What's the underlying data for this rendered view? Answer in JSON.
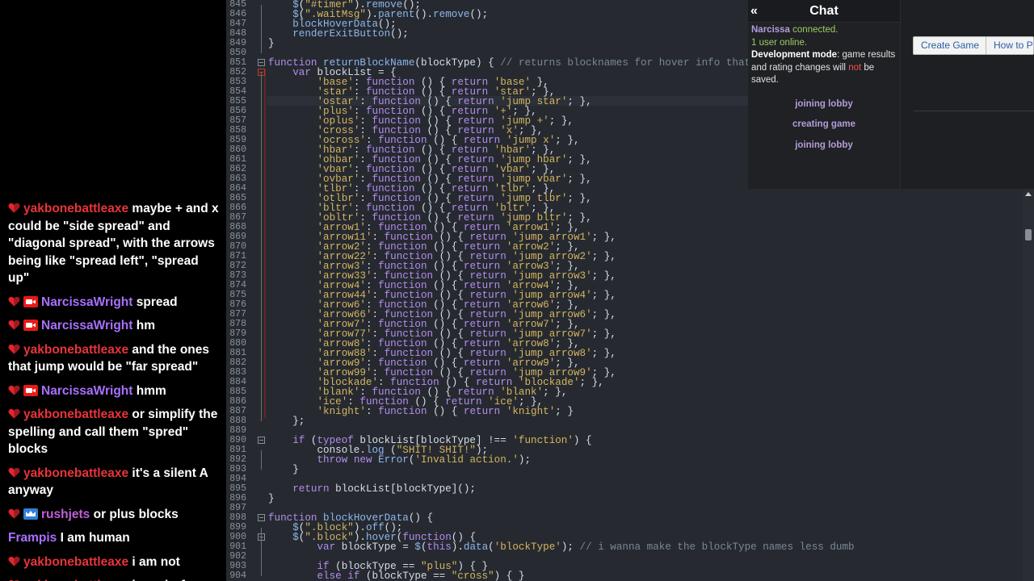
{
  "stream_chat": {
    "messages": [
      {
        "user": "yakbonebattleaxe",
        "color": "#e8343a",
        "badges": [
          "heart"
        ],
        "text": "maybe + and x could be \"side spread\" and \"diagonal spread\", with the arrows being like \"spread left\", \"spread up\""
      },
      {
        "user": "NarcissaWright",
        "color": "#a970ff",
        "badges": [
          "heart",
          "camera"
        ],
        "text": "spread"
      },
      {
        "user": "NarcissaWright",
        "color": "#a970ff",
        "badges": [
          "heart",
          "camera"
        ],
        "text": "hm"
      },
      {
        "user": "yakbonebattleaxe",
        "color": "#e8343a",
        "badges": [
          "heart"
        ],
        "text": "and the ones that jump would be \"far spread\""
      },
      {
        "user": "NarcissaWright",
        "color": "#a970ff",
        "badges": [
          "heart",
          "camera"
        ],
        "text": "hmm"
      },
      {
        "user": "yakbonebattleaxe",
        "color": "#e8343a",
        "badges": [
          "heart"
        ],
        "text": "or simplify the spelling and call them \"spred\" blocks"
      },
      {
        "user": "yakbonebattleaxe",
        "color": "#e8343a",
        "badges": [
          "heart"
        ],
        "text": "it's a silent A anyway"
      },
      {
        "user": "rushjets",
        "color": "#c15ed8",
        "badges": [
          "heart",
          "crown"
        ],
        "text": "or plus blocks"
      },
      {
        "user": "Frampis",
        "color": "#a970ff",
        "badges": [],
        "text": "I am human"
      },
      {
        "user": "yakbonebattleaxe",
        "color": "#e8343a",
        "badges": [
          "heart"
        ],
        "text": "i am not"
      },
      {
        "user": "yakbonebattleaxe",
        "color": "#e8343a",
        "badges": [
          "heart"
        ],
        "text": "i am dorf"
      }
    ]
  },
  "editor": {
    "lines": [
      {
        "n": "845",
        "html": "    <span class=\"fn\">$</span>(<span class=\"str\">\"#timer\"</span>).<span class=\"fn\">remove</span>();"
      },
      {
        "n": "846",
        "html": "    <span class=\"fn\">$</span>(<span class=\"str\">\".waitMsg\"</span>).<span class=\"fn\">parent</span>().<span class=\"fn\">remove</span>();"
      },
      {
        "n": "847",
        "html": "    <span class=\"fn\">blockHoverData</span>();"
      },
      {
        "n": "848",
        "html": "    <span class=\"fn\">renderExitButton</span>();"
      },
      {
        "n": "849",
        "html": "}"
      },
      {
        "n": "850",
        "html": ""
      },
      {
        "n": "851",
        "html": "<span class=\"kw\">function</span> <span class=\"fn\">returnBlockName</span>(blockType) { <span class=\"cm\">// returns blocknames for hover info that do</span>"
      },
      {
        "n": "852",
        "html": "    <span class=\"kw\">var</span> blockList = {"
      },
      {
        "n": "853",
        "html": "        <span class=\"str\">'base'</span>: <span class=\"kw\">function</span> () { <span class=\"kw\">return</span> <span class=\"str\">'base'</span> },"
      },
      {
        "n": "854",
        "html": "        <span class=\"str\">'star'</span>: <span class=\"kw\">function</span> () { <span class=\"kw\">return</span> <span class=\"str\">'star'</span>; },"
      },
      {
        "n": "855",
        "html": "        <span class=\"str\">'ostar'</span>: <span class=\"kw\">function</span> () { <span class=\"kw\">return</span> <span class=\"str\">'jump star'</span>; },"
      },
      {
        "n": "856",
        "html": "        <span class=\"str\">'plus'</span>: <span class=\"kw\">function</span> () { <span class=\"kw\">return</span> <span class=\"str\">'+'</span>; },"
      },
      {
        "n": "857",
        "html": "        <span class=\"str\">'oplus'</span>: <span class=\"kw\">function</span> () { <span class=\"kw\">return</span> <span class=\"str\">'jump +'</span>; },"
      },
      {
        "n": "858",
        "html": "        <span class=\"str\">'cross'</span>: <span class=\"kw\">function</span> () { <span class=\"kw\">return</span> <span class=\"str\">'x'</span>; },"
      },
      {
        "n": "859",
        "html": "        <span class=\"str\">'ocross'</span>: <span class=\"kw\">function</span> () { <span class=\"kw\">return</span> <span class=\"str\">'jump x'</span>; },"
      },
      {
        "n": "860",
        "html": "        <span class=\"str\">'hbar'</span>: <span class=\"kw\">function</span> () { <span class=\"kw\">return</span> <span class=\"str\">'hbar'</span>; },"
      },
      {
        "n": "861",
        "html": "        <span class=\"str\">'ohbar'</span>: <span class=\"kw\">function</span> () { <span class=\"kw\">return</span> <span class=\"str\">'jump hbar'</span>; },"
      },
      {
        "n": "862",
        "html": "        <span class=\"str\">'vbar'</span>: <span class=\"kw\">function</span> () { <span class=\"kw\">return</span> <span class=\"str\">'vbar'</span>; },"
      },
      {
        "n": "863",
        "html": "        <span class=\"str\">'ovbar'</span>: <span class=\"kw\">function</span> () { <span class=\"kw\">return</span> <span class=\"str\">'jump vbar'</span>; },"
      },
      {
        "n": "864",
        "html": "        <span class=\"str\">'tlbr'</span>: <span class=\"kw\">function</span> () { <span class=\"kw\">return</span> <span class=\"str\">'tlbr'</span>; },"
      },
      {
        "n": "865",
        "html": "        <span class=\"str\">'otlbr'</span>: <span class=\"kw\">function</span> () { <span class=\"kw\">return</span> <span class=\"str\">'jump tlbr'</span>; },"
      },
      {
        "n": "866",
        "html": "        <span class=\"str\">'bltr'</span>: <span class=\"kw\">function</span> () { <span class=\"kw\">return</span> <span class=\"str\">'bltr'</span>; },"
      },
      {
        "n": "867",
        "html": "        <span class=\"str\">'obltr'</span>: <span class=\"kw\">function</span> () { <span class=\"kw\">return</span> <span class=\"str\">'jump bltr'</span>; },"
      },
      {
        "n": "868",
        "html": "        <span class=\"str\">'arrow1'</span>: <span class=\"kw\">function</span> () { <span class=\"kw\">return</span> <span class=\"str\">'arrow1'</span>; },"
      },
      {
        "n": "869",
        "html": "        <span class=\"str\">'arrow11'</span>: <span class=\"kw\">function</span> () { <span class=\"kw\">return</span> <span class=\"str\">'jump arrow1'</span>; },"
      },
      {
        "n": "870",
        "html": "        <span class=\"str\">'arrow2'</span>: <span class=\"kw\">function</span> () { <span class=\"kw\">return</span> <span class=\"str\">'arrow2'</span>; },"
      },
      {
        "n": "871",
        "html": "        <span class=\"str\">'arrow22'</span>: <span class=\"kw\">function</span> () { <span class=\"kw\">return</span> <span class=\"str\">'jump arrow2'</span>; },"
      },
      {
        "n": "872",
        "html": "        <span class=\"str\">'arrow3'</span>: <span class=\"kw\">function</span> () { <span class=\"kw\">return</span> <span class=\"str\">'arrow3'</span>; },"
      },
      {
        "n": "873",
        "html": "        <span class=\"str\">'arrow33'</span>: <span class=\"kw\">function</span> () { <span class=\"kw\">return</span> <span class=\"str\">'jump arrow3'</span>; },"
      },
      {
        "n": "874",
        "html": "        <span class=\"str\">'arrow4'</span>: <span class=\"kw\">function</span> () { <span class=\"kw\">return</span> <span class=\"str\">'arrow4'</span>; },"
      },
      {
        "n": "875",
        "html": "        <span class=\"str\">'arrow44'</span>: <span class=\"kw\">function</span> () { <span class=\"kw\">return</span> <span class=\"str\">'jump arrow4'</span>; },"
      },
      {
        "n": "876",
        "html": "        <span class=\"str\">'arrow6'</span>: <span class=\"kw\">function</span> () { <span class=\"kw\">return</span> <span class=\"str\">'arrow6'</span>; },"
      },
      {
        "n": "877",
        "html": "        <span class=\"str\">'arrow66'</span>: <span class=\"kw\">function</span> () { <span class=\"kw\">return</span> <span class=\"str\">'jump arrow6'</span>; },"
      },
      {
        "n": "878",
        "html": "        <span class=\"str\">'arrow7'</span>: <span class=\"kw\">function</span> () { <span class=\"kw\">return</span> <span class=\"str\">'arrow7'</span>; },"
      },
      {
        "n": "879",
        "html": "        <span class=\"str\">'arrow77'</span>: <span class=\"kw\">function</span> () { <span class=\"kw\">return</span> <span class=\"str\">'jump arrow7'</span>; },"
      },
      {
        "n": "880",
        "html": "        <span class=\"str\">'arrow8'</span>: <span class=\"kw\">function</span> () { <span class=\"kw\">return</span> <span class=\"str\">'arrow8'</span>; },"
      },
      {
        "n": "881",
        "html": "        <span class=\"str\">'arrow88'</span>: <span class=\"kw\">function</span> () { <span class=\"kw\">return</span> <span class=\"str\">'jump arrow8'</span>; },"
      },
      {
        "n": "882",
        "html": "        <span class=\"str\">'arrow9'</span>: <span class=\"kw\">function</span> () { <span class=\"kw\">return</span> <span class=\"str\">'arrow9'</span>; },"
      },
      {
        "n": "883",
        "html": "        <span class=\"str\">'arrow99'</span>: <span class=\"kw\">function</span> () { <span class=\"kw\">return</span> <span class=\"str\">'jump arrow9'</span>; },"
      },
      {
        "n": "884",
        "html": "        <span class=\"str\">'blockade'</span>: <span class=\"kw\">function</span> () { <span class=\"kw\">return</span> <span class=\"str\">'blockade'</span>; },"
      },
      {
        "n": "885",
        "html": "        <span class=\"str\">'blank'</span>: <span class=\"kw\">function</span> () { <span class=\"kw\">return</span> <span class=\"str\">'blank'</span>; },"
      },
      {
        "n": "886",
        "html": "        <span class=\"str\">'ice'</span>: <span class=\"kw\">function</span> () { <span class=\"kw\">return</span> <span class=\"str\">'ice'</span>; },"
      },
      {
        "n": "887",
        "html": "        <span class=\"str\">'knight'</span>: <span class=\"kw\">function</span> () { <span class=\"kw\">return</span> <span class=\"str\">'knight'</span>; }"
      },
      {
        "n": "888",
        "html": "    };"
      },
      {
        "n": "889",
        "html": ""
      },
      {
        "n": "890",
        "html": "    <span class=\"kw\">if</span> (<span class=\"kw\">typeof</span> blockList[blockType] !== <span class=\"str\">'function'</span>) {"
      },
      {
        "n": "891",
        "html": "        console.<span class=\"fn\">log</span> (<span class=\"str\">\"SHIT! SHIT!\"</span>);"
      },
      {
        "n": "892",
        "html": "        <span class=\"kw\">throw</span> <span class=\"kw\">new</span> <span class=\"fn\">Error</span>(<span class=\"str\">'Invalid action.'</span>);"
      },
      {
        "n": "893",
        "html": "    }"
      },
      {
        "n": "894",
        "html": ""
      },
      {
        "n": "895",
        "html": "    <span class=\"kw\">return</span> blockList[blockType]();"
      },
      {
        "n": "896",
        "html": "}"
      },
      {
        "n": "897",
        "html": ""
      },
      {
        "n": "898",
        "html": "<span class=\"kw\">function</span> <span class=\"fn\">blockHoverData</span>() {"
      },
      {
        "n": "899",
        "html": "    <span class=\"fn\">$</span>(<span class=\"str\">\".block\"</span>).<span class=\"fn\">off</span>();"
      },
      {
        "n": "900",
        "html": "    <span class=\"fn\">$</span>(<span class=\"str\">\".block\"</span>).<span class=\"fn\">hover</span>(<span class=\"kw\">function</span>() {"
      },
      {
        "n": "901",
        "html": "        <span class=\"kw\">var</span> blockType = <span class=\"fn\">$</span>(<span class=\"kw\">this</span>).<span class=\"fn\">data</span>(<span class=\"str\">'blockType'</span>); <span class=\"cm\">// i wanna make the blockType names less dumb</span>"
      },
      {
        "n": "902",
        "html": ""
      },
      {
        "n": "903",
        "html": "        <span class=\"kw\">if</span> (blockType == <span class=\"str\">\"plus\"</span>) { }"
      },
      {
        "n": "904",
        "html": "        <span class=\"kw\">else if</span> (blockType == <span class=\"str\">\"cross\"</span>) { }"
      }
    ]
  },
  "site_chat": {
    "collapse_glyph": "«",
    "title": "Chat",
    "log_user": "Narcissa",
    "log_connected": " connected.",
    "log_online": "1 user online.",
    "log_dev_label": "Development mode",
    "log_dev_text_1": ": game results and rating changes will ",
    "log_dev_not": "not",
    "log_dev_text_2": " be saved.",
    "status_rows": [
      "joining lobby",
      "creating game",
      "joining lobby"
    ],
    "create_game_label": "Create Game",
    "how_to_label": "How to P"
  }
}
